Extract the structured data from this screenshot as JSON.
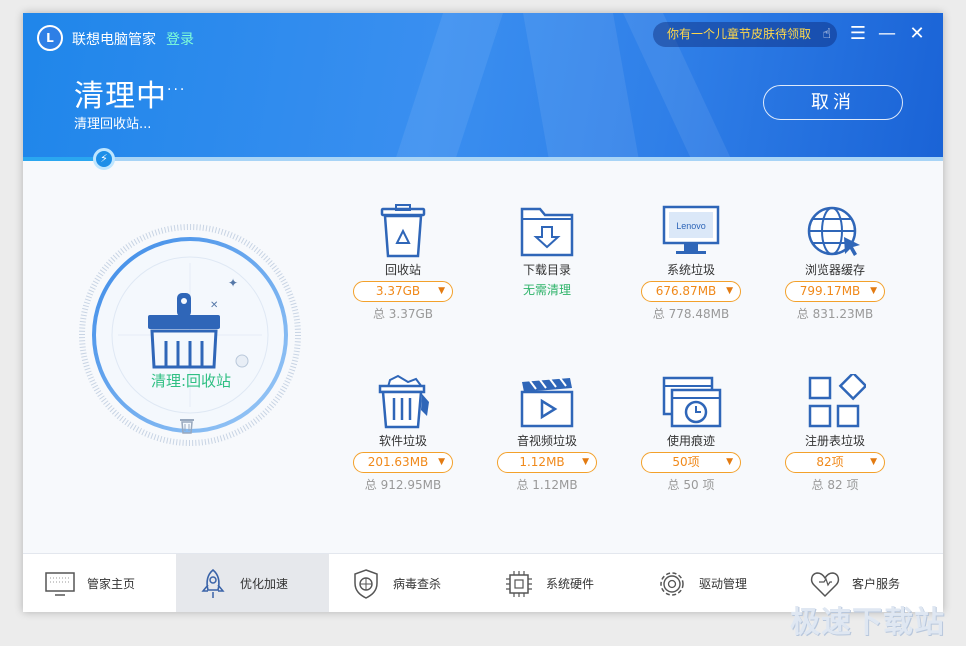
{
  "header": {
    "app_name": "联想电脑管家",
    "login_label": "登录",
    "promo_text": "你有一个儿童节皮肤待领取",
    "status_title": "清理中",
    "status_dots": "···",
    "status_detail": "清理回收站...",
    "cancel_label": "取消"
  },
  "progress": {
    "fraction": 0.09
  },
  "dial": {
    "label": "清理:回收站"
  },
  "items": [
    {
      "name": "回收站",
      "size": "3.37GB",
      "total": "总 3.37GB",
      "icon": "recycle-bin-icon"
    },
    {
      "name": "下载目录",
      "status": "无需清理",
      "icon": "download-folder-icon"
    },
    {
      "name": "系统垃圾",
      "size": "676.87MB",
      "total": "总 778.48MB",
      "icon": "lenovo-monitor-icon",
      "monitor_brand": "Lenovo"
    },
    {
      "name": "浏览器缓存",
      "size": "799.17MB",
      "total": "总 831.23MB",
      "icon": "browser-globe-icon"
    },
    {
      "name": "软件垃圾",
      "size": "201.63MB",
      "total": "总 912.95MB",
      "icon": "software-trash-icon"
    },
    {
      "name": "音视频垃圾",
      "size": "1.12MB",
      "total": "总 1.12MB",
      "icon": "video-clapper-icon"
    },
    {
      "name": "使用痕迹",
      "size": "50项",
      "total": "总 50 项",
      "icon": "history-clock-icon"
    },
    {
      "name": "注册表垃圾",
      "size": "82项",
      "total": "总 82 项",
      "icon": "registry-blocks-icon"
    }
  ],
  "nav": [
    {
      "label": "管家主页",
      "icon": "monitor-icon"
    },
    {
      "label": "优化加速",
      "icon": "rocket-icon",
      "active": true
    },
    {
      "label": "病毒查杀",
      "icon": "shield-icon"
    },
    {
      "label": "系统硬件",
      "icon": "chip-icon"
    },
    {
      "label": "驱动管理",
      "icon": "gear-icon"
    },
    {
      "label": "客户服务",
      "icon": "heart-icon"
    }
  ],
  "watermark": "极速下载站",
  "colors": {
    "header_blue": "#2e87ec",
    "accent_orange": "#f3a12b",
    "accent_green": "#2fbf83",
    "icon_blue": "#2f66b8"
  }
}
